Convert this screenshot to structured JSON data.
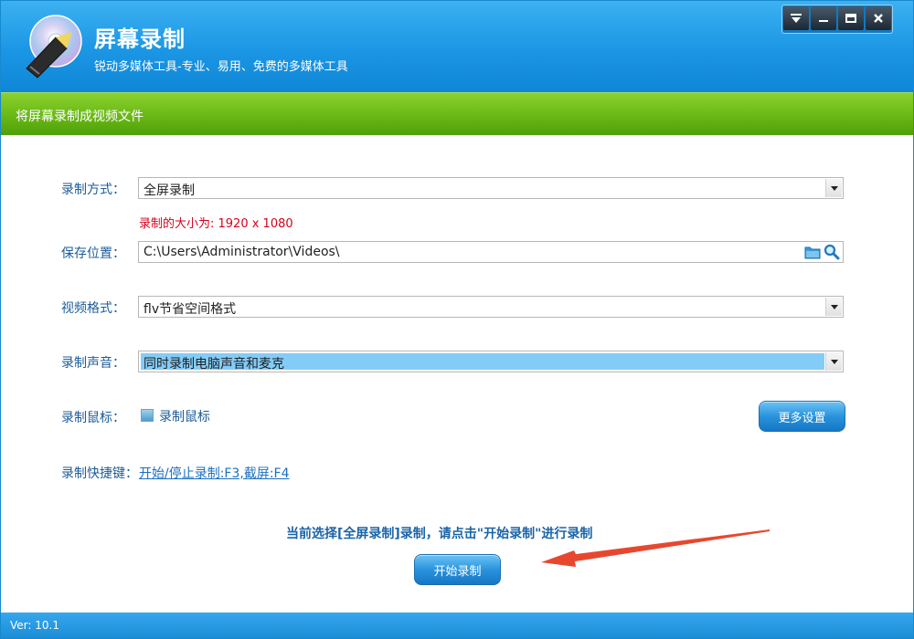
{
  "window": {
    "title": "屏幕录制",
    "subtitle": "锐动多媒体工具-专业、易用、免费的多媒体工具"
  },
  "banner": {
    "text": "将屏幕录制成视频文件"
  },
  "form": {
    "record_mode": {
      "label": "录制方式：",
      "value": "全屏录制"
    },
    "size_info": "录制的大小为: 1920 x 1080",
    "save_location": {
      "label": "保存位置：",
      "value": "C:\\Users\\Administrator\\Videos\\"
    },
    "video_format": {
      "label": "视频格式：",
      "value": "flv节省空间格式"
    },
    "audio": {
      "label": "录制声音：",
      "value": "同时录制电脑声音和麦克"
    },
    "mouse": {
      "label": "录制鼠标：",
      "checkbox_label": "录制鼠标",
      "checked": false
    },
    "hotkey": {
      "label": "录制快捷键：",
      "link": "开始/停止录制:F3,截屏:F4"
    }
  },
  "buttons": {
    "more_settings": "更多设置",
    "start_record": "开始录制"
  },
  "status_message": "当前选择[全屏录制]录制，请点击\"开始录制\"进行录制",
  "footer": {
    "version": "Ver: 10.1"
  },
  "colors": {
    "title_blue": "#1b96e4",
    "banner_green": "#6cbb17",
    "label_blue": "#1c5c98",
    "size_red": "#d6001c",
    "highlight": "#84ccf8",
    "arrow_red": "#e8472f"
  }
}
